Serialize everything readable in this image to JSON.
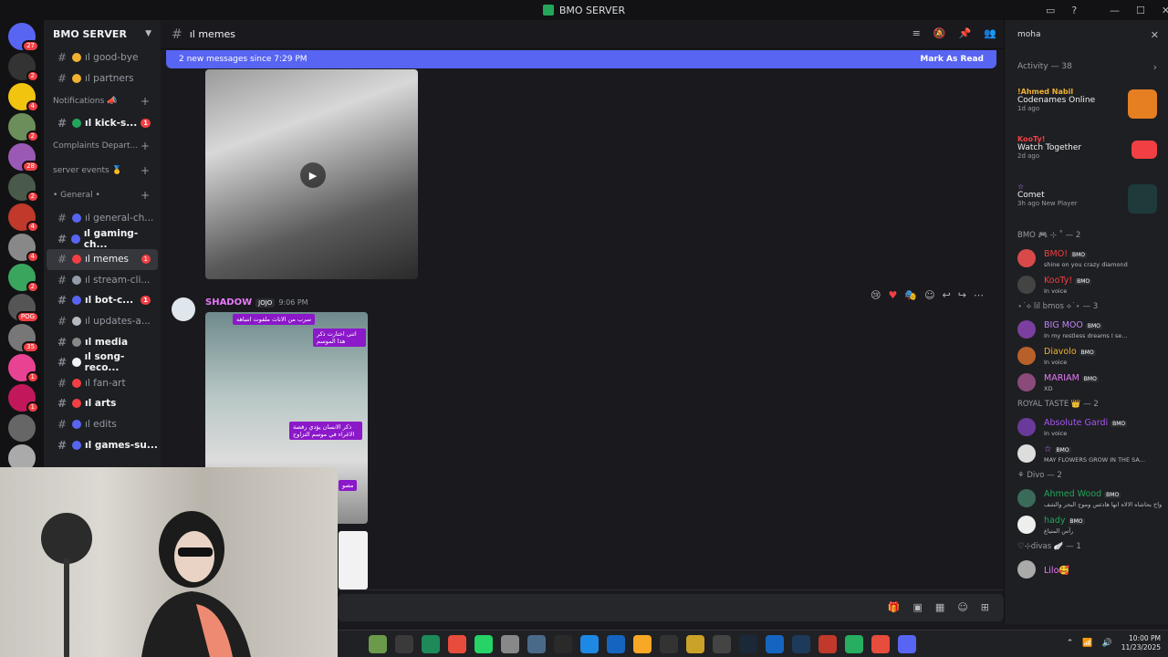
{
  "window": {
    "title": "BMO SERVER"
  },
  "servers": {
    "badges": [
      "27",
      "2",
      "4",
      "2",
      "28",
      "2",
      "4",
      "4",
      "2",
      "POG",
      "35",
      "1",
      "1"
    ]
  },
  "sidebar": {
    "server_name": "BMO SERVER",
    "items": [
      {
        "label": "ıl good-bye",
        "type": "channel"
      },
      {
        "label": "ıl partners",
        "type": "channel"
      },
      {
        "label": "Notifications 📣",
        "type": "category"
      },
      {
        "label": "ıl kick-s...",
        "type": "channel",
        "unread": true,
        "count": "1"
      },
      {
        "label": "Complaints Depart...",
        "type": "category"
      },
      {
        "label": "server events 🥇",
        "type": "category"
      },
      {
        "label": "• General •",
        "type": "category"
      },
      {
        "label": "ıl general-ch...",
        "type": "channel"
      },
      {
        "label": "ıl gaming-ch...",
        "type": "channel",
        "unread": true
      },
      {
        "label": "ıl memes",
        "type": "channel",
        "active": true,
        "count": "1"
      },
      {
        "label": "ıl stream-cli...",
        "type": "channel"
      },
      {
        "label": "ıl bot-c...",
        "type": "channel",
        "unread": true,
        "count": "1"
      },
      {
        "label": "ıl updates-a...",
        "type": "channel"
      },
      {
        "label": "ıl media",
        "type": "channel",
        "unread": true
      },
      {
        "label": "ıl song-reco...",
        "type": "channel",
        "unread": true
      },
      {
        "label": "ıl fan-art",
        "type": "channel"
      },
      {
        "label": "ıl arts",
        "type": "channel",
        "unread": true
      },
      {
        "label": "ıl edits",
        "type": "channel"
      },
      {
        "label": "ıl games-su...",
        "type": "channel",
        "unread": true
      }
    ]
  },
  "header": {
    "channel": "ıl memes"
  },
  "banner": {
    "text": "2 new messages since 7:29 PM",
    "action": "Mark As Read"
  },
  "message": {
    "author": "SHADOW",
    "tag": "JOJO",
    "time": "9:06 PM",
    "labels": [
      "سرب من الاناث ملفوت انتباهه",
      "اثنى اختارت ذكر هذا الموسم",
      "ذكر الانسان يؤدي رقصة الاغراء في موسم التزاوج",
      "مصو"
    ]
  },
  "search": {
    "value": "moha"
  },
  "activity": {
    "header": "Activity — 38",
    "items": [
      {
        "who": "!Ahmed Nabil",
        "game": "Codenames Online",
        "ago": "1d ago"
      },
      {
        "who": "KooTy!",
        "game": "Watch Together",
        "ago": "2d ago"
      },
      {
        "who": "☆",
        "game": "Comet",
        "ago": "3h ago",
        "extra": "New Player"
      }
    ]
  },
  "groups": [
    {
      "title": "BMO 🎮 ⊹ ˚ — 2",
      "members": [
        {
          "name": "BMO!",
          "tag": "BMO",
          "sub": "shine on you crazy diamond",
          "color": "#f23f43"
        },
        {
          "name": "KooTy!",
          "tag": "BMO",
          "sub": "In voice",
          "color": "#f23f43"
        }
      ]
    },
    {
      "title": "⋆˙⟡ lil bmos ⟡˙⋆ — 3",
      "members": [
        {
          "name": "BIG MOO",
          "tag": "BMO",
          "sub": "In my restless dreams I se...",
          "color": "#c084fc"
        },
        {
          "name": "Diavolo",
          "tag": "BMO",
          "sub": "In voice",
          "color": "#f0b132"
        },
        {
          "name": "MARIAM",
          "tag": "BMO",
          "sub": "XD",
          "color": "#e879f9"
        }
      ]
    },
    {
      "title": "ROYAL TASTE 👑 — 2",
      "members": [
        {
          "name": "Absolute Gardi",
          "tag": "BMO",
          "sub": "In voice",
          "color": "#a855f7"
        },
        {
          "name": "☆",
          "tag": "BMO",
          "sub": "MAY FLOWERS GROW IN THE SA...",
          "color": "#c084fc"
        }
      ]
    },
    {
      "title": "⚘ Divo — 2",
      "members": [
        {
          "name": "Ahmed Wood",
          "tag": "BMO",
          "sub": "واخ بحاشاه الالاه انها هادئس وموج البحر والشف",
          "color": "#23a55a"
        },
        {
          "name": "hady",
          "tag": "BMO",
          "sub": "رأس المتياع",
          "color": "#23a55a"
        }
      ]
    },
    {
      "title": "♡⊹divas 🪽 — 1",
      "members": [
        {
          "name": "Lilo🥰",
          "tag": "",
          "sub": "",
          "color": "#e879f9"
        }
      ]
    }
  ],
  "clock": {
    "time": "10:00 PM",
    "date": "11/23/2025"
  }
}
